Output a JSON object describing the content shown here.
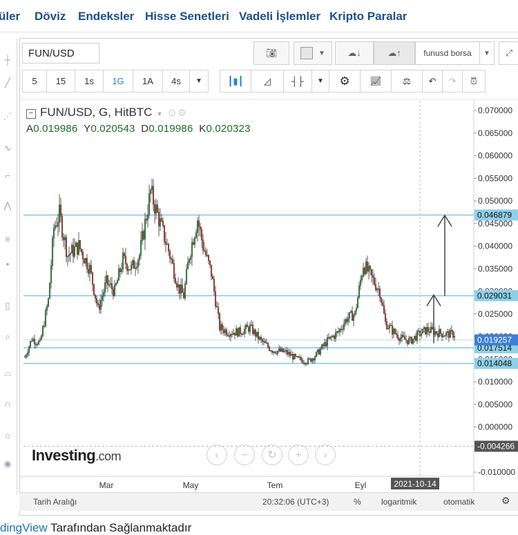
{
  "topnav": {
    "items": [
      "üler",
      "Döviz",
      "Endeksler",
      "Hisse Senetleri",
      "Vadeli İşlemler",
      "Kripto Paralar"
    ]
  },
  "toolbar": {
    "symbol": "FUN/USD",
    "save_label": "funusd borsa",
    "intervals": [
      "5",
      "15",
      "1s",
      "1G",
      "1A",
      "4s"
    ],
    "active_interval": "1G"
  },
  "legend": {
    "title": "FUN/USD, G, HitBTC",
    "ohlc": [
      {
        "k": "A",
        "v": "0.019986"
      },
      {
        "k": "Y",
        "v": "0.020543"
      },
      {
        "k": "D",
        "v": "0.019986"
      },
      {
        "k": "K",
        "v": "0.020323"
      }
    ]
  },
  "colors": {
    "up": "#2e8b3e",
    "down": "#b03a2e",
    "hline": "#7fc8e8",
    "accent": "#2a7fd4",
    "current": "#3d7fd6",
    "label_bg": "#8fd0e8"
  },
  "chart_data": {
    "type": "candlestick",
    "title": "FUN/USD, G, HitBTC",
    "ylim": [
      -0.01,
      0.07
    ],
    "yticks": [
      "0.070000",
      "0.065000",
      "0.060000",
      "0.055000",
      "0.050000",
      "0.045000",
      "0.040000",
      "0.035000",
      "0.030000",
      "0.025000",
      "0.020000",
      "0.015000",
      "0.010000",
      "0.005000",
      "0.000000",
      "-0.010000"
    ],
    "x_labels": [
      {
        "label": "Mar",
        "day": 60
      },
      {
        "label": "May",
        "day": 121
      },
      {
        "label": "Tem",
        "day": 182
      },
      {
        "label": "Eyl",
        "day": 244
      }
    ],
    "crosshair_date": "2021-10-14",
    "crosshair_day": 287,
    "crosshair_value": "-0.004266",
    "current_price": "0.019257",
    "horizontal_lines": [
      {
        "value": 0.046879,
        "label": "0.046879"
      },
      {
        "value": 0.029031,
        "label": "0.029031"
      },
      {
        "value": 0.017514,
        "label": "0.017514"
      },
      {
        "value": 0.014048,
        "label": "0.014048"
      }
    ],
    "arrows": [
      {
        "day": 297,
        "from": 0.0185,
        "to": 0.0292
      },
      {
        "day": 305,
        "from": 0.029,
        "to": 0.0468
      }
    ],
    "price_path": [
      [
        1,
        0.0155
      ],
      [
        6,
        0.0195
      ],
      [
        12,
        0.0185
      ],
      [
        18,
        0.028
      ],
      [
        22,
        0.044
      ],
      [
        26,
        0.047
      ],
      [
        32,
        0.038
      ],
      [
        40,
        0.04
      ],
      [
        48,
        0.035
      ],
      [
        54,
        0.026
      ],
      [
        60,
        0.032
      ],
      [
        66,
        0.03
      ],
      [
        72,
        0.037
      ],
      [
        78,
        0.035
      ],
      [
        84,
        0.038
      ],
      [
        92,
        0.052
      ],
      [
        100,
        0.044
      ],
      [
        106,
        0.038
      ],
      [
        112,
        0.031
      ],
      [
        116,
        0.029
      ],
      [
        120,
        0.038
      ],
      [
        126,
        0.046
      ],
      [
        130,
        0.04
      ],
      [
        136,
        0.034
      ],
      [
        142,
        0.022
      ],
      [
        148,
        0.021
      ],
      [
        156,
        0.021
      ],
      [
        164,
        0.022
      ],
      [
        172,
        0.019
      ],
      [
        180,
        0.017
      ],
      [
        190,
        0.0165
      ],
      [
        198,
        0.015
      ],
      [
        206,
        0.0145
      ],
      [
        212,
        0.016
      ],
      [
        220,
        0.019
      ],
      [
        228,
        0.021
      ],
      [
        234,
        0.024
      ],
      [
        240,
        0.025
      ],
      [
        246,
        0.036
      ],
      [
        252,
        0.033
      ],
      [
        258,
        0.03
      ],
      [
        262,
        0.023
      ],
      [
        268,
        0.021
      ],
      [
        274,
        0.0195
      ],
      [
        280,
        0.019
      ],
      [
        286,
        0.0205
      ],
      [
        292,
        0.0215
      ],
      [
        298,
        0.021
      ],
      [
        306,
        0.0205
      ],
      [
        312,
        0.0205
      ]
    ]
  },
  "bottombar": {
    "range_label": "Tarih Aralığı",
    "time": "20:32:06 (UTC+3)",
    "percent": "%",
    "log": "logaritmik",
    "auto": "otomatik"
  },
  "logo": {
    "name": "Investing",
    "suffix": ".com"
  },
  "caption": {
    "link": "dingView",
    "text": " Tarafından Sağlanmaktadır"
  }
}
